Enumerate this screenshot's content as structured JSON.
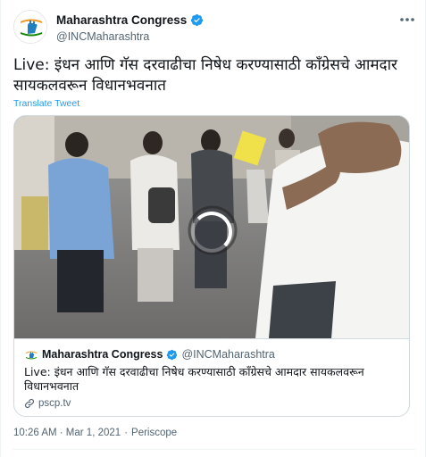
{
  "tweet": {
    "author_name": "Maharashtra Congress",
    "author_handle": "@INCMaharashtra",
    "text": "Live: इंधन आणि गॅस दरवाढीचा निषेध करण्यासाठी काँग्रेसचे आमदार सायकलवरून विधानभवनात",
    "translate_label": "Translate Tweet",
    "timestamp": "10:26 AM · Mar 1, 2021",
    "separator": "·",
    "source": "Periscope"
  },
  "card": {
    "author_name": "Maharashtra Congress",
    "author_handle": "@INCMaharashtra",
    "text": "Live: इंधन आणि गॅस दरवाढीचा निषेध करण्यासाठी काँग्रेसचे आमदार सायकलवरून विधानभवनात",
    "link": "pscp.tv"
  },
  "icons": {
    "verified": "verified-badge-icon",
    "more": "more-horizontal-icon",
    "link": "link-icon",
    "spinner": "loading-spinner-icon"
  },
  "colors": {
    "accent": "#1d9bf0",
    "text_primary": "#0f1419",
    "text_secondary": "#536471",
    "border": "#cfd9de"
  }
}
